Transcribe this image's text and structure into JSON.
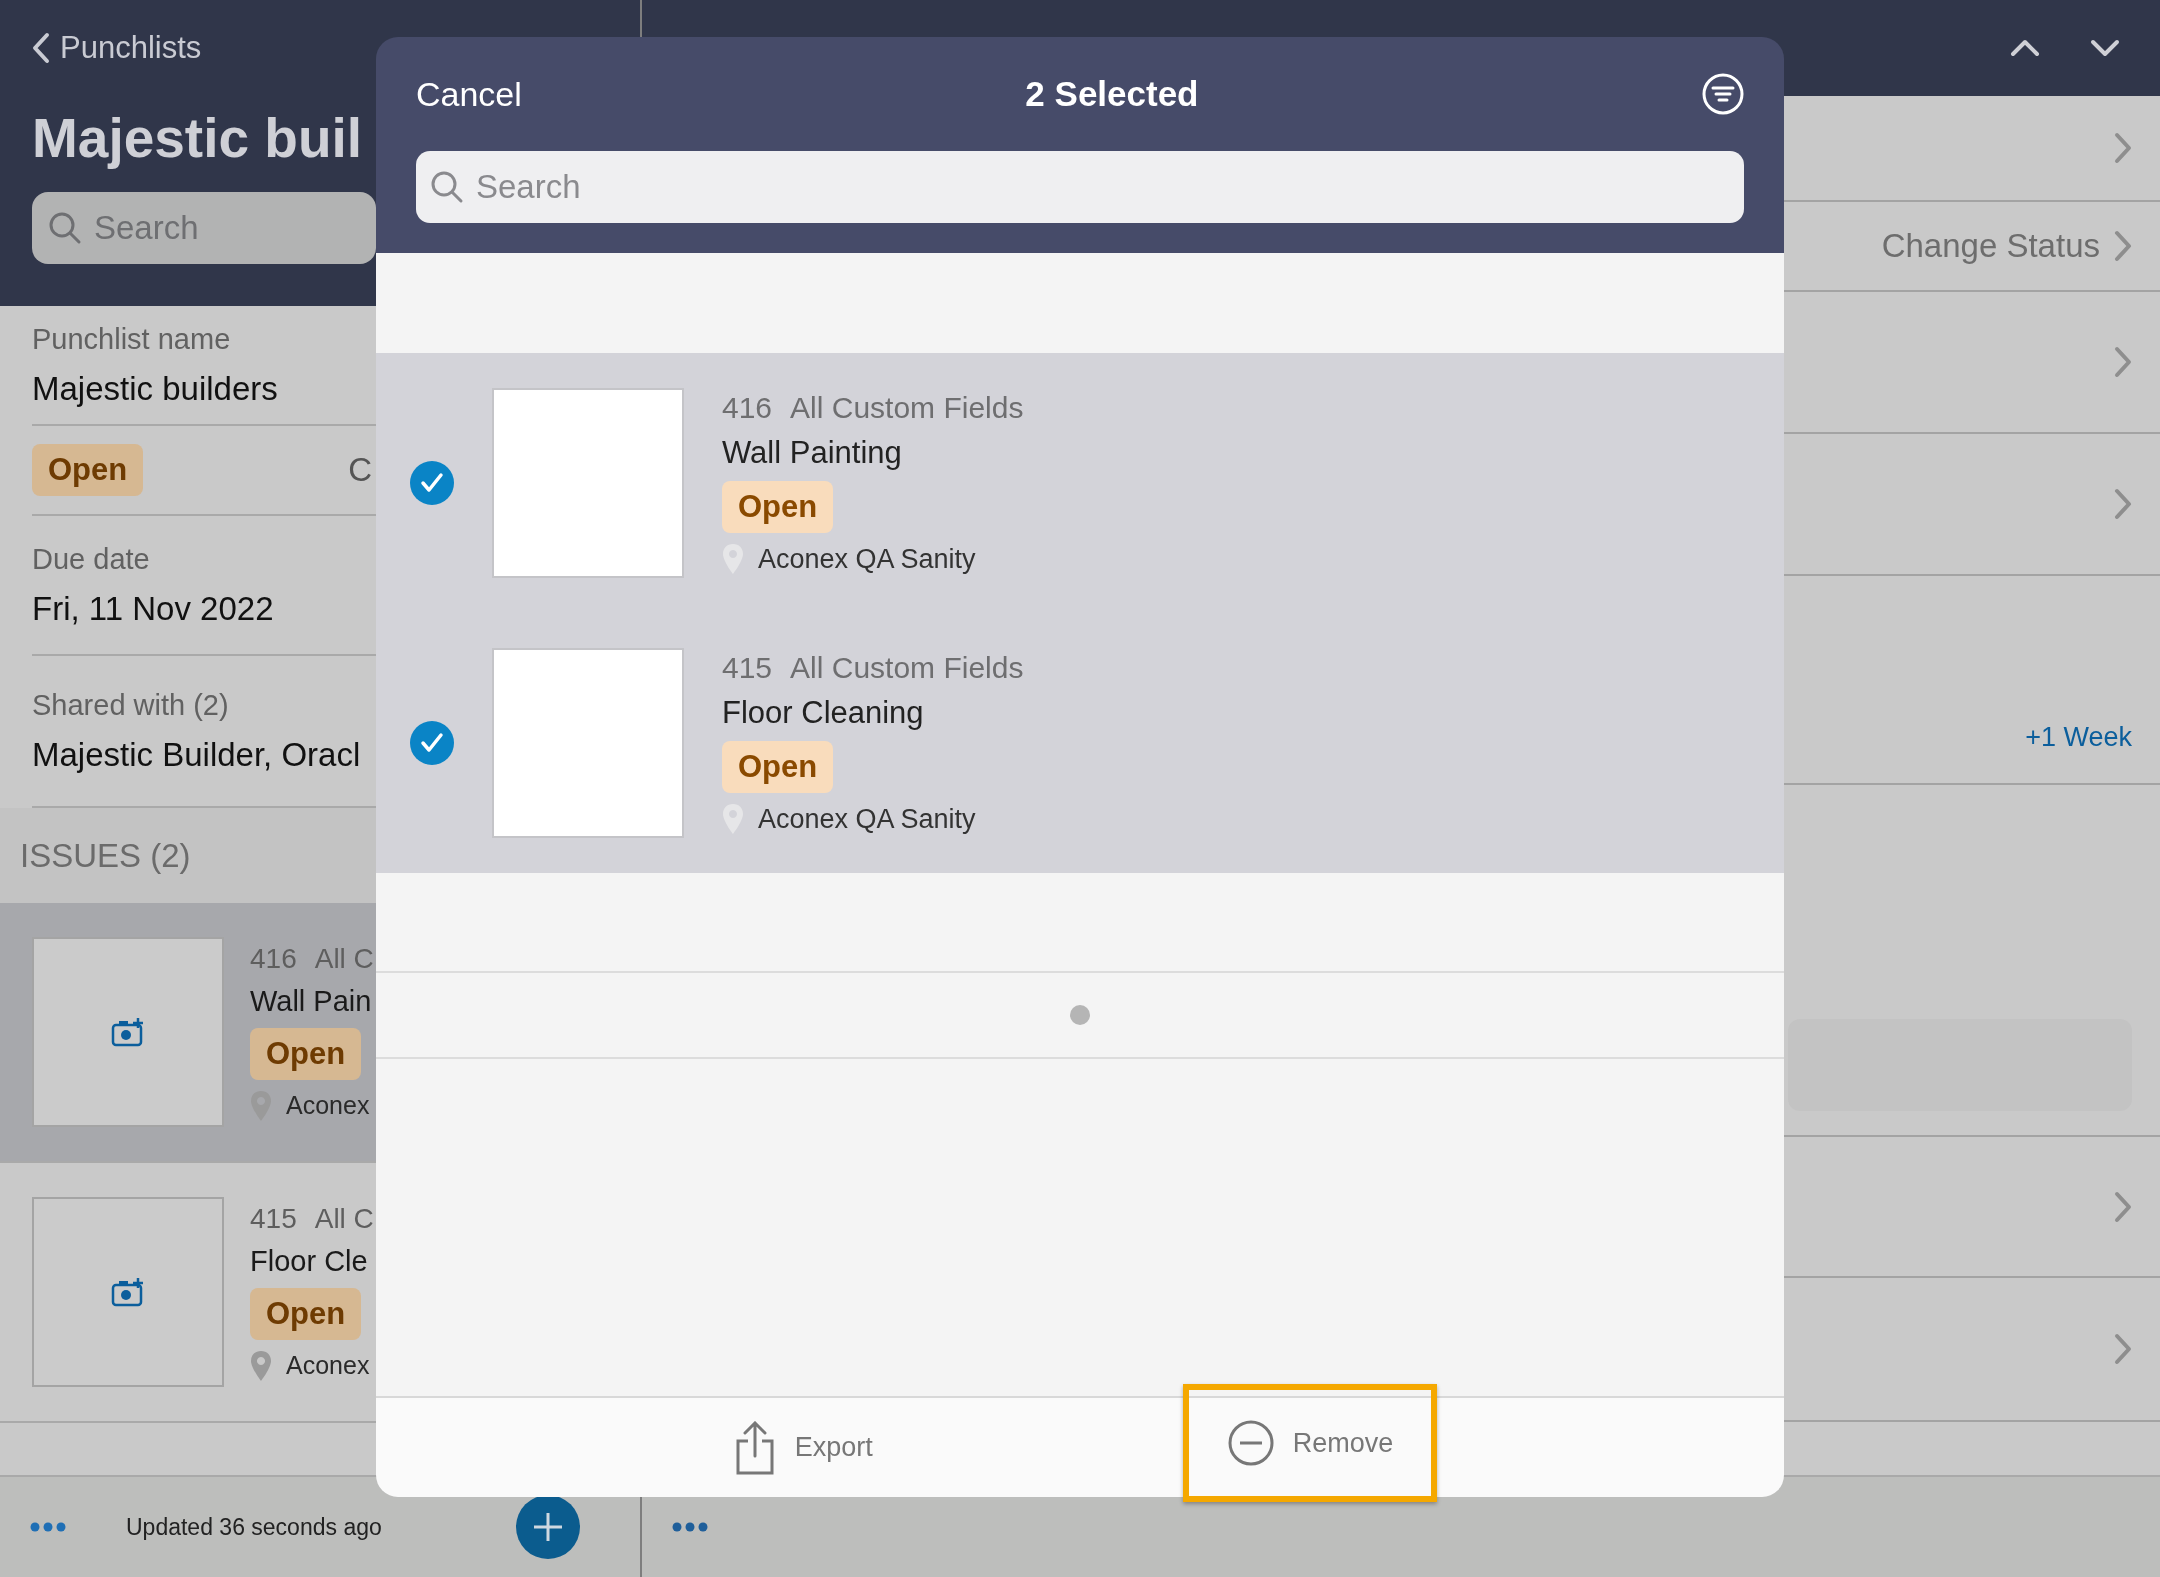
{
  "left_panel": {
    "back_label": "Punchlists",
    "title": "Majestic buil",
    "search": {
      "placeholder": "Search"
    },
    "fields": [
      {
        "kind": "text",
        "label": "Punchlist name",
        "value": "Majestic builders"
      },
      {
        "kind": "status",
        "badge": "Open",
        "value": "C"
      },
      {
        "kind": "text",
        "label": "Due date",
        "value": "Fri, 11 Nov 2022"
      },
      {
        "kind": "text",
        "label": "Shared with (2)",
        "value": "Majestic Builder, Oracl"
      }
    ],
    "section_title": "ISSUES (2)",
    "issues": [
      {
        "number": "416",
        "type": "All C",
        "name": "Wall Pain",
        "status": "Open",
        "location": "Aconex",
        "selected": true
      },
      {
        "number": "415",
        "type": "All C",
        "name": "Floor Cle",
        "status": "Open",
        "location": "Aconex",
        "selected": false
      }
    ],
    "footer_text": "Updated 36 seconds ago"
  },
  "right_panel": {
    "rows": [
      {
        "kind": "nav"
      },
      {
        "kind": "nav",
        "label": "Change Status"
      },
      {
        "kind": "nav"
      },
      {
        "kind": "nav"
      },
      {
        "kind": "link",
        "label": "+1 Week"
      },
      {
        "kind": "field"
      },
      {
        "kind": "nav"
      },
      {
        "kind": "nav"
      }
    ]
  },
  "modal": {
    "cancel": "Cancel",
    "title": "2 Selected",
    "search": {
      "placeholder": "Search"
    },
    "items": [
      {
        "number": "416",
        "type": "All Custom Fields",
        "name": "Wall Painting",
        "status": "Open",
        "location": "Aconex QA Sanity",
        "checked": true
      },
      {
        "number": "415",
        "type": "All Custom Fields",
        "name": "Floor Cleaning",
        "status": "Open",
        "location": "Aconex QA Sanity",
        "checked": true
      }
    ],
    "actions": [
      {
        "kind": "export",
        "label": "Export",
        "highlighted": false
      },
      {
        "kind": "remove",
        "label": "Remove",
        "highlighted": true
      }
    ]
  }
}
